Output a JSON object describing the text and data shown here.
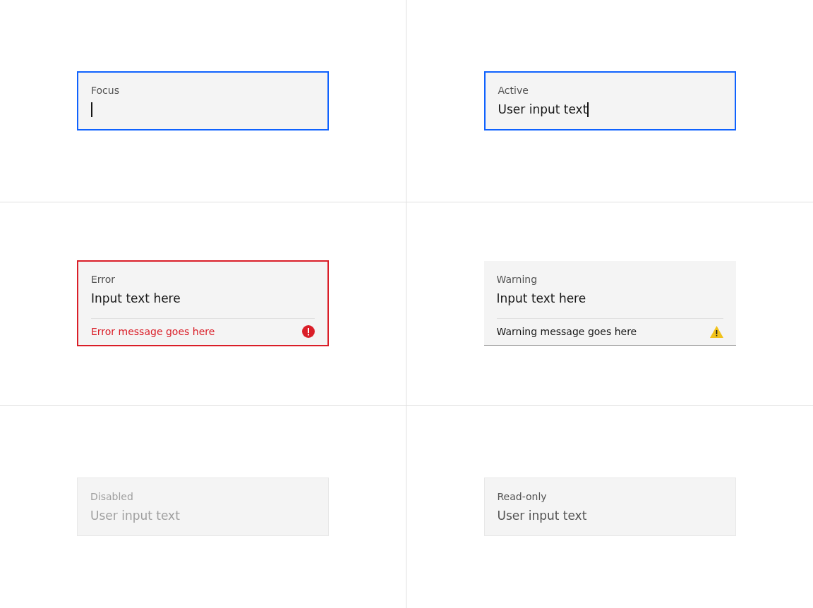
{
  "fields": [
    {
      "kind": "focus",
      "label": "Focus",
      "caret": true
    },
    {
      "kind": "active",
      "label": "Active",
      "value": "User input text",
      "caret": true
    },
    {
      "kind": "error",
      "label": "Error",
      "value": "Input text here",
      "caret": false,
      "message": "Error message goes here"
    },
    {
      "kind": "warning",
      "label": "Warning",
      "value": "Input text here",
      "caret": false,
      "message": "Warning message goes here"
    },
    {
      "kind": "disabled",
      "label": "Disabled",
      "value": "User input text",
      "caret": false
    },
    {
      "kind": "readonly",
      "label": "Read-only",
      "value": "User input text",
      "caret": false
    }
  ]
}
